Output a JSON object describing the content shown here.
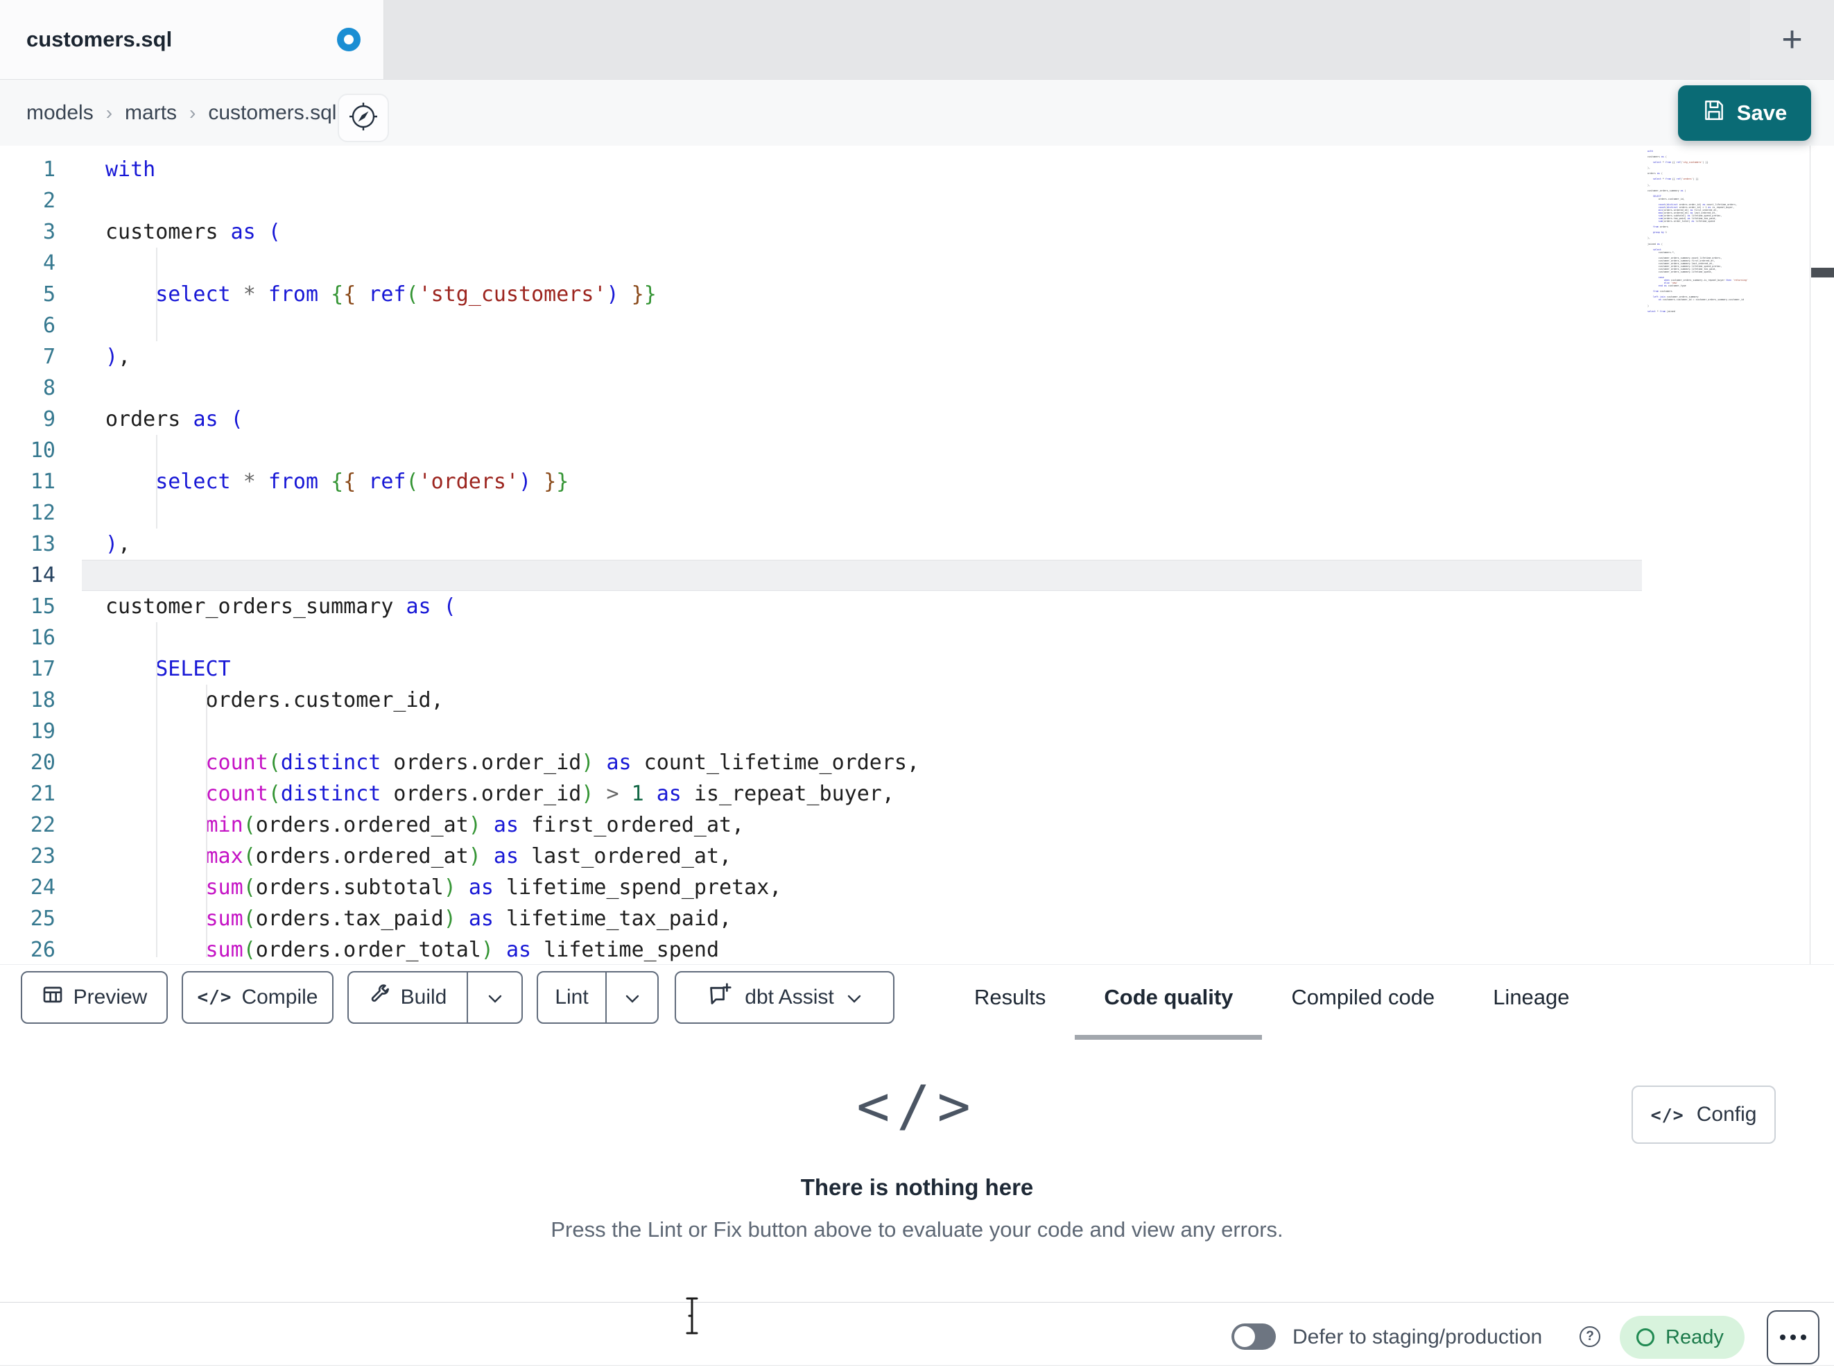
{
  "tab_bar": {
    "active_tab_label": "customers.sql",
    "new_tab_button": "+"
  },
  "breadcrumb": {
    "items": [
      "models",
      "marts",
      "customers.sql"
    ],
    "separator": "›"
  },
  "header": {
    "save_label": "Save"
  },
  "icons": {
    "code_glyph": "</>"
  },
  "editor": {
    "active_line": 14,
    "lines": [
      {
        "tokens": [
          [
            "k",
            "with"
          ]
        ]
      },
      {
        "tokens": []
      },
      {
        "tokens": [
          [
            "t",
            "customers "
          ],
          [
            "k",
            "as"
          ],
          [
            "t",
            " "
          ],
          [
            "p1",
            "("
          ]
        ]
      },
      {
        "tokens": []
      },
      {
        "tokens": [
          [
            "t",
            "    "
          ],
          [
            "k",
            "select"
          ],
          [
            "t",
            " "
          ],
          [
            "o",
            "*"
          ],
          [
            "t",
            " "
          ],
          [
            "k",
            "from"
          ],
          [
            "t",
            " "
          ],
          [
            "p2",
            "{"
          ],
          [
            "p3",
            "{"
          ],
          [
            "t",
            " "
          ],
          [
            "k",
            "ref"
          ],
          [
            "p2",
            "("
          ],
          [
            "s",
            "'stg_customers'"
          ],
          [
            "p1",
            ")"
          ],
          [
            "t",
            " "
          ],
          [
            "p3",
            "}"
          ],
          [
            "p2",
            "}"
          ]
        ]
      },
      {
        "tokens": []
      },
      {
        "tokens": [
          [
            "p1",
            ")"
          ],
          [
            "t",
            ","
          ]
        ]
      },
      {
        "tokens": []
      },
      {
        "tokens": [
          [
            "t",
            "orders "
          ],
          [
            "k",
            "as"
          ],
          [
            "t",
            " "
          ],
          [
            "p1",
            "("
          ]
        ]
      },
      {
        "tokens": []
      },
      {
        "tokens": [
          [
            "t",
            "    "
          ],
          [
            "k",
            "select"
          ],
          [
            "t",
            " "
          ],
          [
            "o",
            "*"
          ],
          [
            "t",
            " "
          ],
          [
            "k",
            "from"
          ],
          [
            "t",
            " "
          ],
          [
            "p2",
            "{"
          ],
          [
            "p3",
            "{"
          ],
          [
            "t",
            " "
          ],
          [
            "k",
            "ref"
          ],
          [
            "p2",
            "("
          ],
          [
            "s",
            "'orders'"
          ],
          [
            "p1",
            ")"
          ],
          [
            "t",
            " "
          ],
          [
            "p3",
            "}"
          ],
          [
            "p2",
            "}"
          ]
        ]
      },
      {
        "tokens": []
      },
      {
        "tokens": [
          [
            "p1",
            ")"
          ],
          [
            "t",
            ","
          ]
        ]
      },
      {
        "tokens": []
      },
      {
        "tokens": [
          [
            "t",
            "customer_orders_summary "
          ],
          [
            "k",
            "as"
          ],
          [
            "t",
            " "
          ],
          [
            "p1",
            "("
          ]
        ]
      },
      {
        "tokens": []
      },
      {
        "tokens": [
          [
            "t",
            "    "
          ],
          [
            "k",
            "SELECT"
          ]
        ]
      },
      {
        "tokens": [
          [
            "t",
            "        orders.customer_id,"
          ]
        ]
      },
      {
        "tokens": []
      },
      {
        "tokens": [
          [
            "t",
            "        "
          ],
          [
            "f",
            "count"
          ],
          [
            "p2",
            "("
          ],
          [
            "k",
            "distinct"
          ],
          [
            "t",
            " orders.order_id"
          ],
          [
            "p2",
            ")"
          ],
          [
            "t",
            " "
          ],
          [
            "k",
            "as"
          ],
          [
            "t",
            " count_lifetime_orders,"
          ]
        ]
      },
      {
        "tokens": [
          [
            "t",
            "        "
          ],
          [
            "f",
            "count"
          ],
          [
            "p2",
            "("
          ],
          [
            "k",
            "distinct"
          ],
          [
            "t",
            " orders.order_id"
          ],
          [
            "p2",
            ")"
          ],
          [
            "t",
            " "
          ],
          [
            "o",
            ">"
          ],
          [
            "t",
            " "
          ],
          [
            "n",
            "1"
          ],
          [
            "t",
            " "
          ],
          [
            "k",
            "as"
          ],
          [
            "t",
            " is_repeat_buyer,"
          ]
        ]
      },
      {
        "tokens": [
          [
            "t",
            "        "
          ],
          [
            "f",
            "min"
          ],
          [
            "p2",
            "("
          ],
          [
            "t",
            "orders.ordered_at"
          ],
          [
            "p2",
            ")"
          ],
          [
            "t",
            " "
          ],
          [
            "k",
            "as"
          ],
          [
            "t",
            " first_ordered_at,"
          ]
        ]
      },
      {
        "tokens": [
          [
            "t",
            "        "
          ],
          [
            "f",
            "max"
          ],
          [
            "p2",
            "("
          ],
          [
            "t",
            "orders.ordered_at"
          ],
          [
            "p2",
            ")"
          ],
          [
            "t",
            " "
          ],
          [
            "k",
            "as"
          ],
          [
            "t",
            " last_ordered_at,"
          ]
        ]
      },
      {
        "tokens": [
          [
            "t",
            "        "
          ],
          [
            "f",
            "sum"
          ],
          [
            "p2",
            "("
          ],
          [
            "t",
            "orders.subtotal"
          ],
          [
            "p2",
            ")"
          ],
          [
            "t",
            " "
          ],
          [
            "k",
            "as"
          ],
          [
            "t",
            " lifetime_spend_pretax,"
          ]
        ]
      },
      {
        "tokens": [
          [
            "t",
            "        "
          ],
          [
            "f",
            "sum"
          ],
          [
            "p2",
            "("
          ],
          [
            "t",
            "orders.tax_paid"
          ],
          [
            "p2",
            ")"
          ],
          [
            "t",
            " "
          ],
          [
            "k",
            "as"
          ],
          [
            "t",
            " lifetime_tax_paid,"
          ]
        ]
      },
      {
        "tokens": [
          [
            "t",
            "        "
          ],
          [
            "f",
            "sum"
          ],
          [
            "p2",
            "("
          ],
          [
            "t",
            "orders.order_total"
          ],
          [
            "p2",
            ")"
          ],
          [
            "t",
            " "
          ],
          [
            "k",
            "as"
          ],
          [
            "t",
            " lifetime_spend"
          ]
        ]
      }
    ]
  },
  "minimap": {
    "lines": [
      "with",
      "",
      "customers as (",
      "",
      "    select * from {{ ref('stg_customers') }}",
      "",
      "),",
      "",
      "orders as (",
      "",
      "    select * from {{ ref('orders') }}",
      "",
      "),",
      "",
      "customer_orders_summary as (",
      "",
      "    SELECT",
      "        orders.customer_id,",
      "",
      "        count(distinct orders.order_id) as count_lifetime_orders,",
      "        count(distinct orders.order_id) > 1 as is_repeat_buyer,",
      "        min(orders.ordered_at) as first_ordered_at,",
      "        max(orders.ordered_at) as last_ordered_at,",
      "        sum(orders.subtotal) as lifetime_spend_pretax,",
      "        sum(orders.tax_paid) as lifetime_tax_paid,",
      "        sum(orders.order_total) as lifetime_spend",
      "",
      "    from orders",
      "",
      "    group by 1",
      "",
      "),",
      "",
      "joined as (",
      "",
      "    select",
      "        customers.*,",
      "",
      "        customer_orders_summary.count_lifetime_orders,",
      "        customer_orders_summary.first_ordered_at,",
      "        customer_orders_summary.last_ordered_at,",
      "        customer_orders_summary.lifetime_spend_pretax,",
      "        customer_orders_summary.lifetime_tax_paid,",
      "        customer_orders_summary.lifetime_spend,",
      "",
      "        case",
      "            when customer_orders_summary.is_repeat_buyer then 'returning'",
      "            else 'new'",
      "        end as customer_type",
      "",
      "    from customers",
      "",
      "    left join customer_orders_summary",
      "        on customers.customer_id = customer_orders_summary.customer_id",
      "",
      ")",
      "",
      "select * from joined"
    ]
  },
  "toolbar": {
    "preview_label": "Preview",
    "compile_label": "Compile",
    "build_label": "Build",
    "lint_label": "Lint",
    "assist_label": "dbt Assist"
  },
  "tabs": [
    {
      "label": "Results",
      "active": false
    },
    {
      "label": "Code quality",
      "active": true
    },
    {
      "label": "Compiled code",
      "active": false
    },
    {
      "label": "Lineage",
      "active": false
    }
  ],
  "empty_state": {
    "icon": "</>",
    "title": "There is nothing here",
    "message": "Press the Lint or Fix button above to evaluate your code and view any errors."
  },
  "panel": {
    "config_label": "Config"
  },
  "status_bar": {
    "defer_label": "Defer to staging/production",
    "ready_label": "Ready"
  },
  "colors": {
    "accent_teal": "#0a6b75",
    "unsaved_dot_blue": "#1b8ed3",
    "ready_green": "#1b7a4a",
    "ready_bg": "#d8f3dd",
    "keyword_blue": "#1717d6",
    "function_magenta": "#c513c5",
    "string_red": "#9c241e",
    "number_green": "#116644"
  }
}
